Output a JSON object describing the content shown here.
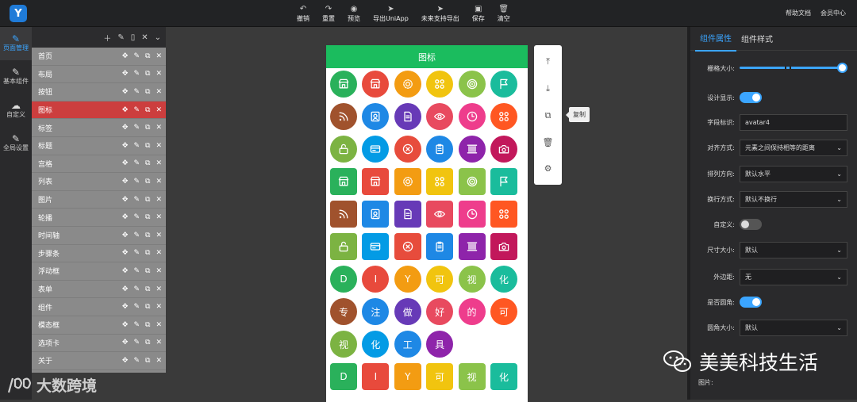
{
  "app": {
    "logo_text": "Y"
  },
  "toolbar": {
    "items": [
      {
        "label": "撤销",
        "icon": "undo-icon",
        "glyph": "↶"
      },
      {
        "label": "重置",
        "icon": "redo-icon",
        "glyph": "↷"
      },
      {
        "label": "预览",
        "icon": "eye-icon",
        "glyph": "◉"
      },
      {
        "label": "导出UniApp",
        "icon": "send-icon",
        "glyph": "➤"
      },
      {
        "label": "未来支持导出",
        "icon": "send-icon",
        "glyph": "➤"
      },
      {
        "label": "保存",
        "icon": "save-icon",
        "glyph": "▣"
      },
      {
        "label": "清空",
        "icon": "trash-icon",
        "glyph": "🗑"
      }
    ],
    "right": [
      "帮助文档",
      "会员中心"
    ]
  },
  "leftnav": [
    {
      "label": "页面管理",
      "icon": "pen-icon",
      "glyph": "✎",
      "active": true
    },
    {
      "label": "基本组件",
      "icon": "pen-icon",
      "glyph": "✎",
      "active": false
    },
    {
      "label": "自定义",
      "icon": "cloud-icon",
      "glyph": "☁",
      "active": false
    },
    {
      "label": "全局设置",
      "icon": "pen-icon",
      "glyph": "✎",
      "active": false
    }
  ],
  "pages": {
    "head_icons": [
      "＋",
      "✎",
      "▯",
      "✕",
      "⌄"
    ],
    "items": [
      "首页",
      "布局",
      "按钮",
      "图标",
      "标签",
      "标题",
      "宫格",
      "列表",
      "图片",
      "轮播",
      "时间轴",
      "步骤条",
      "浮动框",
      "表单",
      "组件",
      "模态框",
      "选项卡",
      "关于"
    ],
    "active_index": 3
  },
  "phone": {
    "title": "图标",
    "icon_cells": [
      {
        "shape": "circle",
        "color": "#2ab15b",
        "icon": "store-icon"
      },
      {
        "shape": "circle",
        "color": "#e84a3c",
        "icon": "store-icon"
      },
      {
        "shape": "circle",
        "color": "#f39c12",
        "icon": "gear-icon"
      },
      {
        "shape": "circle",
        "color": "#f1c40f",
        "icon": "apps-icon"
      },
      {
        "shape": "circle",
        "color": "#8bc34a",
        "icon": "signal-icon"
      },
      {
        "shape": "circle",
        "color": "#1abc9c",
        "icon": "flag-icon"
      },
      {
        "shape": "circle",
        "color": "#a0522d",
        "icon": "rss-icon"
      },
      {
        "shape": "circle",
        "color": "#1e88e5",
        "icon": "contact-icon"
      },
      {
        "shape": "circle",
        "color": "#673ab7",
        "icon": "document-icon"
      },
      {
        "shape": "circle",
        "color": "#e84a5f",
        "icon": "eye-off-icon"
      },
      {
        "shape": "circle",
        "color": "#ee3d8c",
        "icon": "clock-icon"
      },
      {
        "shape": "circle",
        "color": "#ff5722",
        "icon": "apps-icon"
      },
      {
        "shape": "circle",
        "color": "#7cb342",
        "icon": "unlock-icon"
      },
      {
        "shape": "circle",
        "color": "#039be5",
        "icon": "card-icon"
      },
      {
        "shape": "circle",
        "color": "#e74c3c",
        "icon": "close-circle-icon"
      },
      {
        "shape": "circle",
        "color": "#1e88e5",
        "icon": "clipboard-icon"
      },
      {
        "shape": "circle",
        "color": "#8e24aa",
        "icon": "barcode-icon"
      },
      {
        "shape": "circle",
        "color": "#c2185b",
        "icon": "camera-icon"
      },
      {
        "shape": "square",
        "color": "#2ab15b",
        "icon": "store-icon"
      },
      {
        "shape": "square",
        "color": "#e84a3c",
        "icon": "store-icon"
      },
      {
        "shape": "square",
        "color": "#f39c12",
        "icon": "gear-icon"
      },
      {
        "shape": "square",
        "color": "#f1c40f",
        "icon": "apps-icon"
      },
      {
        "shape": "square",
        "color": "#8bc34a",
        "icon": "signal-icon"
      },
      {
        "shape": "square",
        "color": "#1abc9c",
        "icon": "flag-icon"
      },
      {
        "shape": "square",
        "color": "#a0522d",
        "icon": "rss-icon"
      },
      {
        "shape": "square",
        "color": "#1e88e5",
        "icon": "contact-icon"
      },
      {
        "shape": "square",
        "color": "#673ab7",
        "icon": "document-icon"
      },
      {
        "shape": "square",
        "color": "#e84a5f",
        "icon": "eye-off-icon"
      },
      {
        "shape": "square",
        "color": "#ee3d8c",
        "icon": "clock-icon"
      },
      {
        "shape": "square",
        "color": "#ff5722",
        "icon": "apps-icon"
      },
      {
        "shape": "square",
        "color": "#7cb342",
        "icon": "unlock-icon"
      },
      {
        "shape": "square",
        "color": "#039be5",
        "icon": "card-icon"
      },
      {
        "shape": "square",
        "color": "#e74c3c",
        "icon": "close-circle-icon"
      },
      {
        "shape": "square",
        "color": "#1e88e5",
        "icon": "clipboard-icon"
      },
      {
        "shape": "square",
        "color": "#8e24aa",
        "icon": "barcode-icon"
      },
      {
        "shape": "square",
        "color": "#c2185b",
        "icon": "camera-icon"
      }
    ],
    "text_cells": [
      {
        "shape": "circle",
        "color": "#2ab15b",
        "text": "D"
      },
      {
        "shape": "circle",
        "color": "#e84a3c",
        "text": "I"
      },
      {
        "shape": "circle",
        "color": "#f39c12",
        "text": "Y"
      },
      {
        "shape": "circle",
        "color": "#f1c40f",
        "text": "可"
      },
      {
        "shape": "circle",
        "color": "#8bc34a",
        "text": "视"
      },
      {
        "shape": "circle",
        "color": "#1abc9c",
        "text": "化"
      },
      {
        "shape": "circle",
        "color": "#a0522d",
        "text": "专"
      },
      {
        "shape": "circle",
        "color": "#1e88e5",
        "text": "注"
      },
      {
        "shape": "circle",
        "color": "#673ab7",
        "text": "做"
      },
      {
        "shape": "circle",
        "color": "#e84a5f",
        "text": "好"
      },
      {
        "shape": "circle",
        "color": "#ee3d8c",
        "text": "的"
      },
      {
        "shape": "circle",
        "color": "#ff5722",
        "text": "可"
      },
      {
        "shape": "circle",
        "color": "#7cb342",
        "text": "视"
      },
      {
        "shape": "circle",
        "color": "#039be5",
        "text": "化"
      },
      {
        "shape": "circle",
        "color": "#1e88e5",
        "text": "工"
      },
      {
        "shape": "circle",
        "color": "#8e24aa",
        "text": "具"
      },
      {
        "shape": "empty",
        "color": "",
        "text": ""
      },
      {
        "shape": "empty",
        "color": "",
        "text": ""
      },
      {
        "shape": "square",
        "color": "#2ab15b",
        "text": "D"
      },
      {
        "shape": "square",
        "color": "#e84a3c",
        "text": "I"
      },
      {
        "shape": "square",
        "color": "#f39c12",
        "text": "Y"
      },
      {
        "shape": "square",
        "color": "#f1c40f",
        "text": "可"
      },
      {
        "shape": "square",
        "color": "#8bc34a",
        "text": "视"
      },
      {
        "shape": "square",
        "color": "#1abc9c",
        "text": "化"
      }
    ]
  },
  "floatbar": [
    {
      "icon": "move-up-icon",
      "glyph": "⤒"
    },
    {
      "icon": "move-down-icon",
      "glyph": "⤓"
    },
    {
      "icon": "copy-icon",
      "glyph": "⧉"
    },
    {
      "icon": "trash-icon",
      "glyph": "🗑"
    },
    {
      "icon": "settings-icon",
      "glyph": "⚙"
    }
  ],
  "tooltip": "复制",
  "rightpanel": {
    "tabs": [
      "组件属性",
      "组件样式"
    ],
    "active_tab": 0,
    "props": [
      {
        "label": "栅格大小:",
        "type": "slider",
        "value": 24
      },
      {
        "label": "设计显示:",
        "type": "toggle",
        "on": true
      },
      {
        "label": "字段标识:",
        "type": "input",
        "value": "avatar4"
      },
      {
        "label": "对齐方式:",
        "type": "select",
        "value": "元素之间保持相等的距离"
      },
      {
        "label": "排列方向:",
        "type": "select",
        "value": "默认水平"
      },
      {
        "label": "换行方式:",
        "type": "select",
        "value": "默认不换行"
      },
      {
        "label": "自定义:",
        "type": "toggle",
        "on": false
      },
      {
        "label": "尺寸大小:",
        "type": "select",
        "value": "默认"
      },
      {
        "label": "外边距:",
        "type": "select",
        "value": "无"
      },
      {
        "label": "是否圆角:",
        "type": "toggle",
        "on": true
      },
      {
        "label": "圆角大小:",
        "type": "select",
        "value": "默认"
      }
    ],
    "picture_label": "图片:"
  },
  "watermarks": {
    "left": "大数跨境",
    "right": "美美科技生活"
  },
  "colors": {
    "accent": "#3ba5ff",
    "active_page": "#cc3e3e",
    "phone_header": "#1bbc5e"
  }
}
